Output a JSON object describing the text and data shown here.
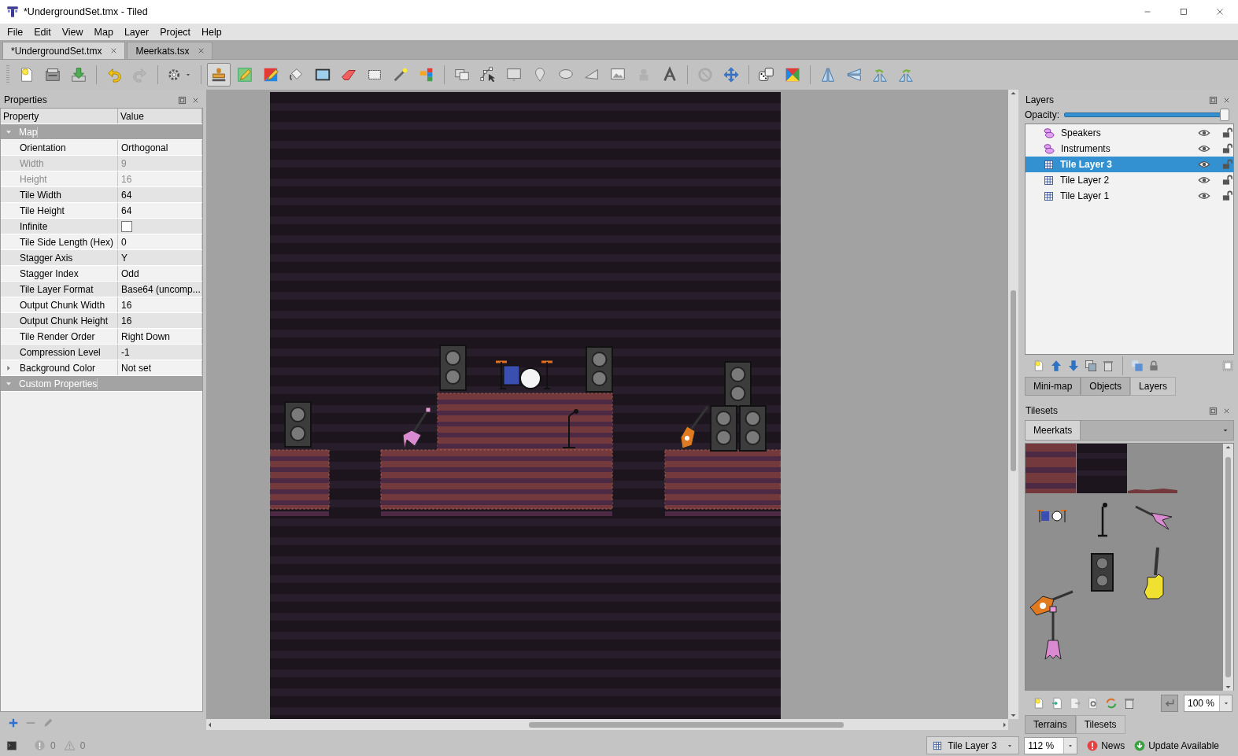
{
  "window": {
    "title": "*UndergroundSet.tmx - Tiled"
  },
  "menu": [
    "File",
    "Edit",
    "View",
    "Map",
    "Layer",
    "Project",
    "Help"
  ],
  "document_tabs": [
    {
      "label": "*UndergroundSet.tmx",
      "selected": true
    },
    {
      "label": "Meerkats.tsx",
      "selected": false
    }
  ],
  "toolbar": [
    {
      "kind": "button",
      "selected": false,
      "disabled": false
    },
    {
      "kind": "button",
      "selected": false,
      "disabled": false
    },
    {
      "kind": "button",
      "selected": false,
      "disabled": false
    },
    {
      "kind": "separator"
    },
    {
      "kind": "button",
      "selected": false,
      "disabled": false
    },
    {
      "kind": "button",
      "selected": false,
      "disabled": true
    },
    {
      "kind": "separator"
    },
    {
      "kind": "button",
      "selected": false,
      "disabled": false
    },
    {
      "kind": "separator"
    },
    {
      "kind": "button",
      "selected": true,
      "disabled": false
    },
    {
      "kind": "button",
      "selected": false,
      "disabled": false
    },
    {
      "kind": "button",
      "selected": false,
      "disabled": false
    },
    {
      "kind": "button",
      "selected": false,
      "disabled": false
    },
    {
      "kind": "button",
      "selected": false,
      "disabled": false
    },
    {
      "kind": "button",
      "selected": false,
      "disabled": false
    },
    {
      "kind": "button",
      "selected": false,
      "disabled": false
    },
    {
      "kind": "button",
      "selected": false,
      "disabled": false
    },
    {
      "kind": "button",
      "selected": false,
      "disabled": false
    },
    {
      "kind": "separator"
    },
    {
      "kind": "button",
      "selected": false,
      "disabled": false
    },
    {
      "kind": "button",
      "selected": false,
      "disabled": false
    },
    {
      "kind": "button",
      "selected": false,
      "disabled": false
    },
    {
      "kind": "button",
      "selected": false,
      "disabled": false
    },
    {
      "kind": "button",
      "selected": false,
      "disabled": false
    },
    {
      "kind": "button",
      "selected": false,
      "disabled": false
    },
    {
      "kind": "button",
      "selected": false,
      "disabled": false
    },
    {
      "kind": "button",
      "selected": false,
      "disabled": true
    },
    {
      "kind": "button",
      "selected": false,
      "disabled": false
    },
    {
      "kind": "separator"
    },
    {
      "kind": "button",
      "selected": false,
      "disabled": true
    },
    {
      "kind": "button",
      "selected": false,
      "disabled": false
    },
    {
      "kind": "separator"
    },
    {
      "kind": "button",
      "selected": false,
      "disabled": false
    },
    {
      "kind": "button",
      "selected": false,
      "disabled": false
    },
    {
      "kind": "separator"
    },
    {
      "kind": "button",
      "selected": false,
      "disabled": false
    },
    {
      "kind": "button",
      "selected": false,
      "disabled": false
    },
    {
      "kind": "button",
      "selected": false,
      "disabled": false
    },
    {
      "kind": "button",
      "selected": false,
      "disabled": false
    }
  ],
  "properties": {
    "title": "Properties",
    "columns": [
      "Property",
      "Value"
    ],
    "rows": [
      {
        "kind": "group",
        "name": "Map",
        "expanded": true
      },
      {
        "kind": "text",
        "name": "Orientation",
        "value": "Orthogonal",
        "disabled": false
      },
      {
        "kind": "text",
        "name": "Width",
        "value": "9",
        "disabled": true
      },
      {
        "kind": "text",
        "name": "Height",
        "value": "16",
        "disabled": true
      },
      {
        "kind": "text",
        "name": "Tile Width",
        "value": "64",
        "disabled": false
      },
      {
        "kind": "text",
        "name": "Tile Height",
        "value": "64",
        "disabled": false
      },
      {
        "kind": "checkbox",
        "name": "Infinite",
        "checked": false
      },
      {
        "kind": "text",
        "name": "Tile Side Length (Hex)",
        "value": "0",
        "disabled": false
      },
      {
        "kind": "text",
        "name": "Stagger Axis",
        "value": "Y",
        "disabled": false
      },
      {
        "kind": "text",
        "name": "Stagger Index",
        "value": "Odd",
        "disabled": false
      },
      {
        "kind": "text",
        "name": "Tile Layer Format",
        "value": "Base64 (uncomp...",
        "disabled": false
      },
      {
        "kind": "text",
        "name": "Output Chunk Width",
        "value": "16",
        "disabled": false
      },
      {
        "kind": "text",
        "name": "Output Chunk Height",
        "value": "16",
        "disabled": false
      },
      {
        "kind": "text",
        "name": "Tile Render Order",
        "value": "Right Down",
        "disabled": false
      },
      {
        "kind": "text",
        "name": "Compression Level",
        "value": "-1",
        "disabled": false
      },
      {
        "kind": "text",
        "name": "Background Color",
        "value": "Not set",
        "disabled": false,
        "expanded": false
      },
      {
        "kind": "group",
        "name": "Custom Properties",
        "expanded": true
      }
    ]
  },
  "layers": {
    "title": "Layers",
    "opacity_label": "Opacity:",
    "opacity": {
      "level": 1
    },
    "items": [
      {
        "name": "Speakers",
        "kind": "object",
        "selected": false,
        "visible": true,
        "locked": false
      },
      {
        "name": "Instruments",
        "kind": "object",
        "selected": false,
        "visible": true,
        "locked": false
      },
      {
        "name": "Tile Layer 3",
        "kind": "tile",
        "selected": true,
        "visible": true,
        "locked": false
      },
      {
        "name": "Tile Layer 2",
        "kind": "tile",
        "selected": false,
        "visible": true,
        "locked": false
      },
      {
        "name": "Tile Layer 1",
        "kind": "tile",
        "selected": false,
        "visible": true,
        "locked": false
      }
    ],
    "tabs": [
      {
        "label": "Mini-map",
        "selected": false
      },
      {
        "label": "Objects",
        "selected": false
      },
      {
        "label": "Layers",
        "selected": true
      }
    ]
  },
  "tilesets": {
    "title": "Tilesets",
    "tabs": [
      {
        "label": "Meerkats",
        "selected": true
      }
    ],
    "zoom": "100 %",
    "bottom_tabs": [
      {
        "label": "Terrains",
        "selected": false
      },
      {
        "label": "Tilesets",
        "selected": true
      }
    ]
  },
  "status_bar": {
    "errors": "0",
    "warnings": "0",
    "current_layer": "Tile Layer 3",
    "zoom": "112 %",
    "news": "News",
    "update": "Update Available"
  }
}
